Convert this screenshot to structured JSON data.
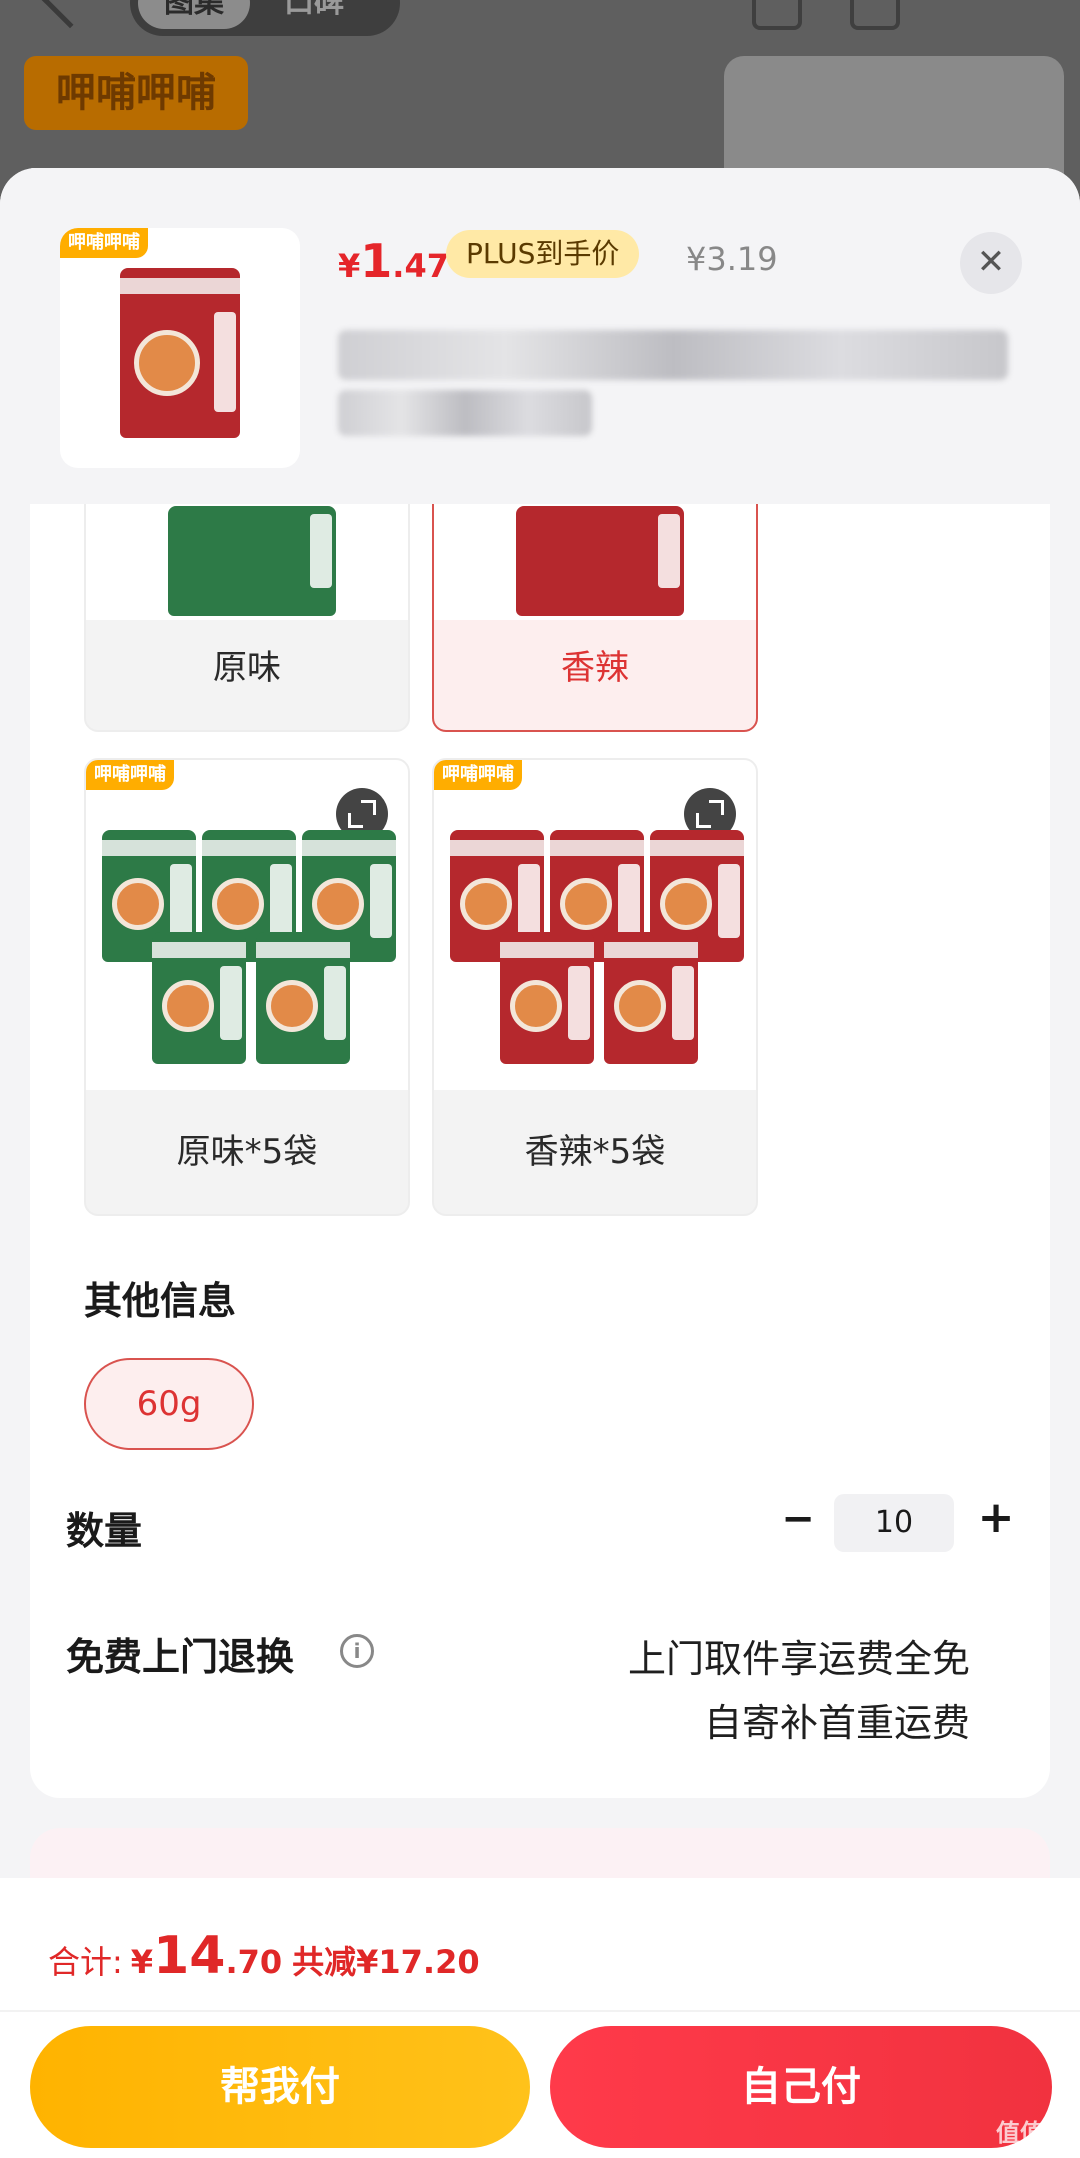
{
  "background": {
    "tabs": [
      "图集",
      "口碑"
    ],
    "brand_logo_text": "呷哺呷哺"
  },
  "header": {
    "price_symbol": "¥",
    "price_main": "1",
    "price_decimal": ".47",
    "plus_badge": "PLUS到手价",
    "original_price": "¥3.19",
    "close_icon": "close-icon",
    "thumb_logo": "呷哺呷哺"
  },
  "variants": [
    {
      "label": "原味",
      "color": "green",
      "selected": false
    },
    {
      "label": "香辣",
      "color": "red",
      "selected": true
    },
    {
      "label": "原味*5袋",
      "color": "green",
      "selected": false,
      "logo": "呷哺呷哺"
    },
    {
      "label": "香辣*5袋",
      "color": "red",
      "selected": false,
      "logo": "呷哺呷哺"
    }
  ],
  "other_info": {
    "title": "其他信息",
    "chip": "60g"
  },
  "quantity": {
    "label": "数量",
    "minus": "−",
    "value": "10",
    "plus": "+"
  },
  "return_service": {
    "label": "免费上门退换",
    "info_icon": "info-icon",
    "line1": "上门取件享运费全免",
    "line2": "自寄补首重运费"
  },
  "footer": {
    "total_label": "合计:",
    "total_symbol": "¥",
    "total_main": "14",
    "total_decimal": ".70",
    "saved": "共减¥17.20",
    "help_pay": "帮我付",
    "self_pay": "自己付",
    "watermark": "值值值"
  },
  "colors": {
    "accent_red": "#e5252a",
    "selected_border": "#d9534f",
    "help_button": "#ffb300",
    "self_button": "#f1323f"
  }
}
